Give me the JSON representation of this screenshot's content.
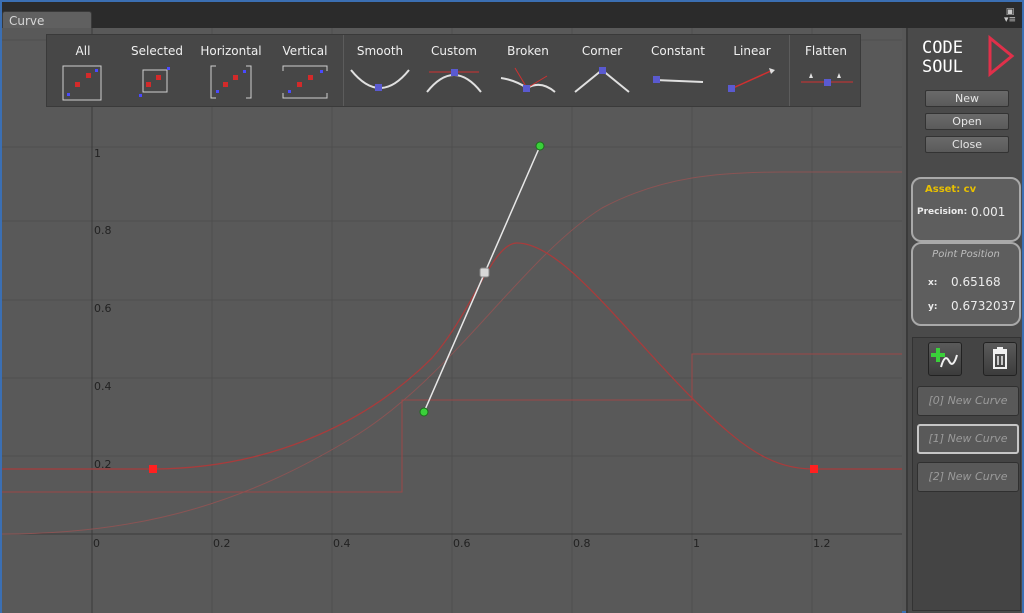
{
  "window": {
    "tab_title": "Curve"
  },
  "toolbar": {
    "buttons": [
      "All",
      "Selected",
      "Horizontal",
      "Vertical",
      "Smooth",
      "Custom",
      "Broken",
      "Corner",
      "Constant",
      "Linear",
      "Flatten"
    ]
  },
  "graph": {
    "x_ticks": [
      "0",
      "0.2",
      "0.4",
      "0.6",
      "0.8",
      "1",
      "1.2"
    ],
    "y_ticks": [
      "1",
      "0.8",
      "0.6",
      "0.4",
      "0.2"
    ],
    "colors": {
      "curve": "#a83c3c",
      "curve_faint": "#8a5454",
      "key": "#ff2020",
      "tangent_handle": "#3ad03a",
      "selected_point": "#d8d8d8"
    }
  },
  "sidebar": {
    "logo_text": [
      "CODE",
      "SOUL"
    ],
    "new_label": "New",
    "open_label": "Open",
    "close_label": "Close",
    "asset": {
      "label": "Asset: cv",
      "precision_label": "Precision:",
      "precision_value": "0.001"
    },
    "point": {
      "title": "Point Position",
      "x_label": "x:",
      "x_value": "0.65168",
      "y_label": "y:",
      "y_value": "0.6732037"
    },
    "curves": [
      "[0]  New Curve",
      "[1]  New Curve",
      "[2]  New Curve"
    ],
    "selected_curve_index": 1
  }
}
